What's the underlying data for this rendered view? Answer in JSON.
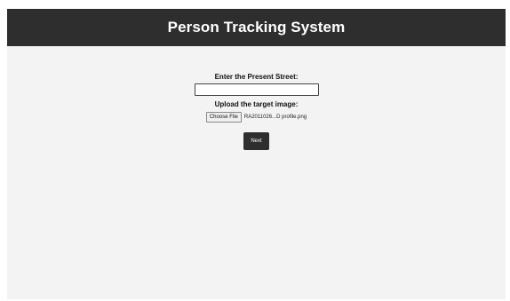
{
  "header": {
    "title": "Person Tracking System"
  },
  "form": {
    "street_label": "Enter the Present Street:",
    "street_value": "",
    "upload_label": "Upload the target image:",
    "choose_file_label": "Choose File",
    "file_name": "RA2011026...D profile.png",
    "next_label": "Next"
  },
  "colors": {
    "header_bg": "#2e2e2e",
    "page_bg": "#f3f3f3",
    "button_bg": "#2e2e2e"
  }
}
